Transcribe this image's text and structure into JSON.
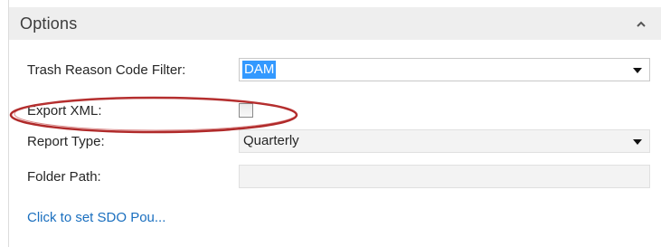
{
  "section": {
    "title": "Options",
    "collapse_icon": "chevron-up-icon"
  },
  "fields": {
    "trash_reason": {
      "label": "Trash Reason Code Filter:",
      "value": "DAM"
    },
    "export_xml": {
      "label": "Export XML:",
      "checked": false
    },
    "report_type": {
      "label": "Report Type:",
      "value": "Quarterly"
    },
    "folder_path": {
      "label": "Folder Path:",
      "value": ""
    }
  },
  "link": {
    "label": "Click to set SDO Pou..."
  },
  "colors": {
    "header_bg": "#eeeeee",
    "selection": "#3399ff",
    "link": "#1a6fbf",
    "annotation": "#b02a2a"
  }
}
